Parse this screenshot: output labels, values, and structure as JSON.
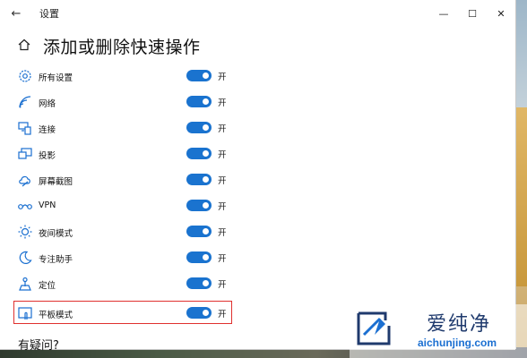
{
  "window": {
    "title": "设置",
    "back_glyph": "←",
    "minimize_glyph": "—",
    "maximize_glyph": "☐",
    "close_glyph": "✕"
  },
  "page": {
    "title": "添加或删除快速操作"
  },
  "accent_color": "#1a73cf",
  "highlight_color": "#e0302e",
  "quick_actions": [
    {
      "label": "所有设置",
      "state": "开",
      "on": true,
      "icon": "gear-icon"
    },
    {
      "label": "网络",
      "state": "开",
      "on": true,
      "icon": "wifi-icon"
    },
    {
      "label": "连接",
      "state": "开",
      "on": true,
      "icon": "connect-icon"
    },
    {
      "label": "投影",
      "state": "开",
      "on": true,
      "icon": "project-icon"
    },
    {
      "label": "屏幕截图",
      "state": "开",
      "on": true,
      "icon": "screen-snip-icon"
    },
    {
      "label": "VPN",
      "state": "开",
      "on": true,
      "icon": "vpn-icon"
    },
    {
      "label": "夜间模式",
      "state": "开",
      "on": true,
      "icon": "night-light-icon"
    },
    {
      "label": "专注助手",
      "state": "开",
      "on": true,
      "icon": "moon-icon"
    },
    {
      "label": "定位",
      "state": "开",
      "on": true,
      "icon": "location-icon"
    },
    {
      "label": "平板模式",
      "state": "开",
      "on": true,
      "icon": "tablet-mode-icon"
    }
  ],
  "help": {
    "heading": "有疑问?"
  },
  "watermark": {
    "brand": "爱纯净",
    "url": "aichunjing.com"
  }
}
